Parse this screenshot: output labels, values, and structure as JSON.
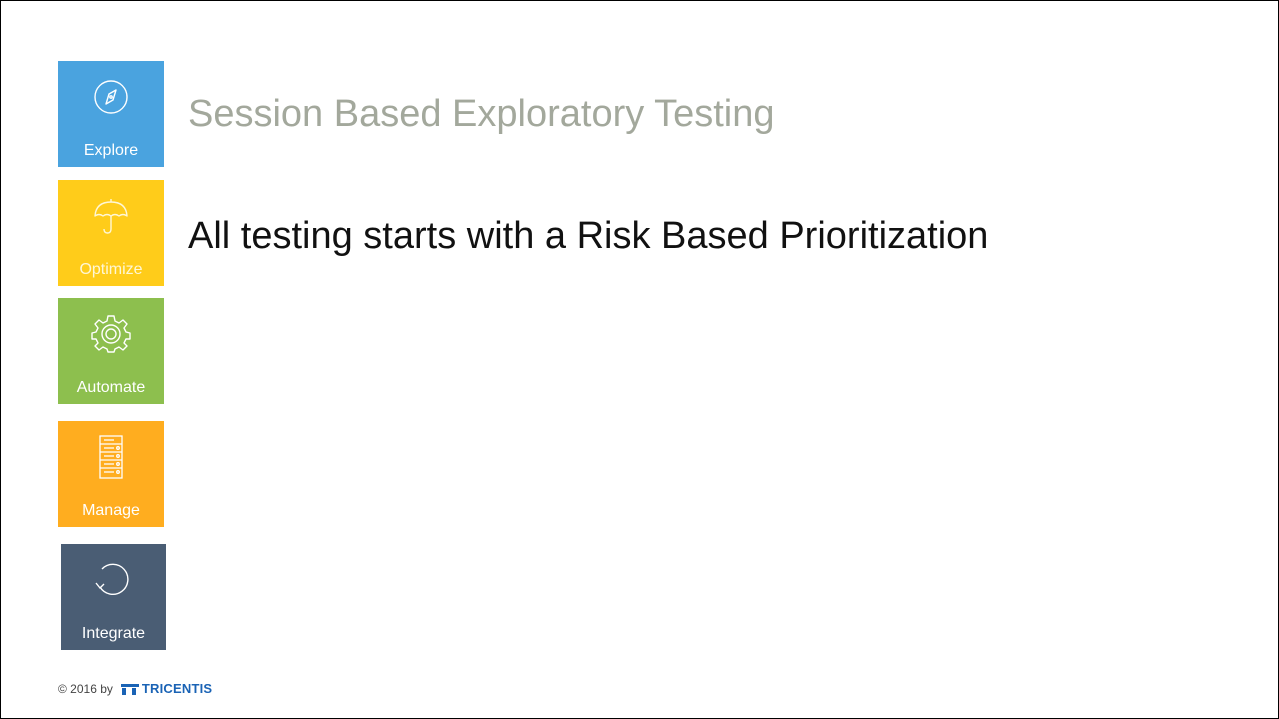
{
  "slide": {
    "title": "Session Based Exploratory Testing",
    "subtitle": "All testing starts with a Risk Based Prioritization"
  },
  "sidebar": {
    "tiles": [
      {
        "label": "Explore",
        "icon": "compass-icon",
        "color": "#4aa3df"
      },
      {
        "label": "Optimize",
        "icon": "umbrella-icon",
        "color": "#ffcc1a"
      },
      {
        "label": "Automate",
        "icon": "gear-icon",
        "color": "#8dbf4e"
      },
      {
        "label": "Manage",
        "icon": "server-icon",
        "color": "#ffad1f"
      },
      {
        "label": "Integrate",
        "icon": "cycle-icon",
        "color": "#4a5d74"
      }
    ]
  },
  "footer": {
    "copyright": "© 2016 by",
    "brand": "TRICENTIS",
    "brand_color": "#1a63b5"
  }
}
